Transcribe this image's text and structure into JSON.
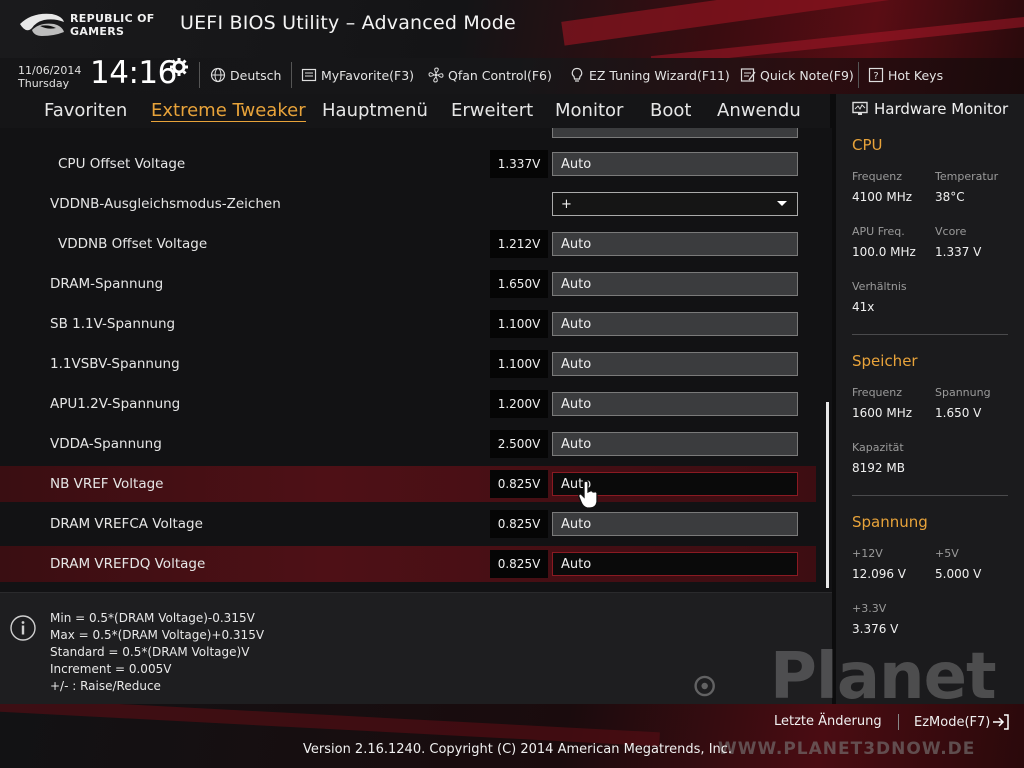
{
  "header": {
    "logo_line1": "REPUBLIC OF",
    "logo_line2": "GAMERS",
    "title": "UEFI BIOS Utility – Advanced Mode"
  },
  "toolbar": {
    "date": "11/06/2014",
    "day": "Thursday",
    "time": "14:16",
    "language": "Deutsch",
    "myfavorite": "MyFavorite(F3)",
    "qfan": "Qfan Control(F6)",
    "ez_tuning": "EZ Tuning Wizard(F11)",
    "quick_note": "Quick Note(F9)",
    "hot_keys": "Hot Keys"
  },
  "tabs": [
    {
      "label": "Favoriten"
    },
    {
      "label": "Extreme Tweaker",
      "active": true
    },
    {
      "label": "Hauptmenü"
    },
    {
      "label": "Erweitert"
    },
    {
      "label": "Monitor"
    },
    {
      "label": "Boot"
    },
    {
      "label": "Anwendu"
    }
  ],
  "settings": [
    {
      "label": "CPU Offset Voltage",
      "value": "1.337V",
      "control": "Auto"
    },
    {
      "label": "VDDNB-Ausgleichsmodus-Zeichen",
      "value": "",
      "control": "+"
    },
    {
      "label": "VDDNB Offset Voltage",
      "value": "1.212V",
      "control": "Auto"
    },
    {
      "label": "DRAM-Spannung",
      "value": "1.650V",
      "control": "Auto"
    },
    {
      "label": "SB 1.1V-Spannung",
      "value": "1.100V",
      "control": "Auto"
    },
    {
      "label": "1.1VSBV-Spannung",
      "value": "1.100V",
      "control": "Auto"
    },
    {
      "label": "APU1.2V-Spannung",
      "value": "1.200V",
      "control": "Auto"
    },
    {
      "label": "VDDA-Spannung",
      "value": "2.500V",
      "control": "Auto"
    },
    {
      "label": "NB VREF Voltage",
      "value": "0.825V",
      "control": "Auto"
    },
    {
      "label": "DRAM VREFCA Voltage",
      "value": "0.825V",
      "control": "Auto"
    },
    {
      "label": "DRAM VREFDQ Voltage",
      "value": "0.825V",
      "control": "Auto"
    }
  ],
  "help": [
    "Min = 0.5*(DRAM Voltage)-0.315V",
    "Max = 0.5*(DRAM Voltage)+0.315V",
    "Standard = 0.5*(DRAM Voltage)V",
    "Increment = 0.005V",
    "+/- : Raise/Reduce"
  ],
  "hw_monitor": {
    "title": "Hardware Monitor",
    "cpu": {
      "heading": "CPU",
      "freq_label": "Frequenz",
      "freq": "4100 MHz",
      "temp_label": "Temperatur",
      "temp": "38°C",
      "apu_label": "APU Freq.",
      "apu": "100.0 MHz",
      "vcore_label": "Vcore",
      "vcore": "1.337 V",
      "ratio_label": "Verhältnis",
      "ratio": "41x"
    },
    "memory": {
      "heading": "Speicher",
      "freq_label": "Frequenz",
      "freq": "1600 MHz",
      "volt_label": "Spannung",
      "volt": "1.650 V",
      "cap_label": "Kapazität",
      "cap": "8192 MB"
    },
    "voltage": {
      "heading": "Spannung",
      "v12_label": "+12V",
      "v12": "12.096 V",
      "v5_label": "+5V",
      "v5": "5.000 V",
      "v33_label": "+3.3V",
      "v33": "3.376 V"
    }
  },
  "footer": {
    "last_change": "Letzte Änderung",
    "ezmode": "EzMode(F7)",
    "version": "Version 2.16.1240. Copyright (C) 2014 American Megatrends, Inc."
  },
  "watermark": {
    "brand": "Planet",
    "url": "WWW.PLANET3DNOW.DE"
  }
}
